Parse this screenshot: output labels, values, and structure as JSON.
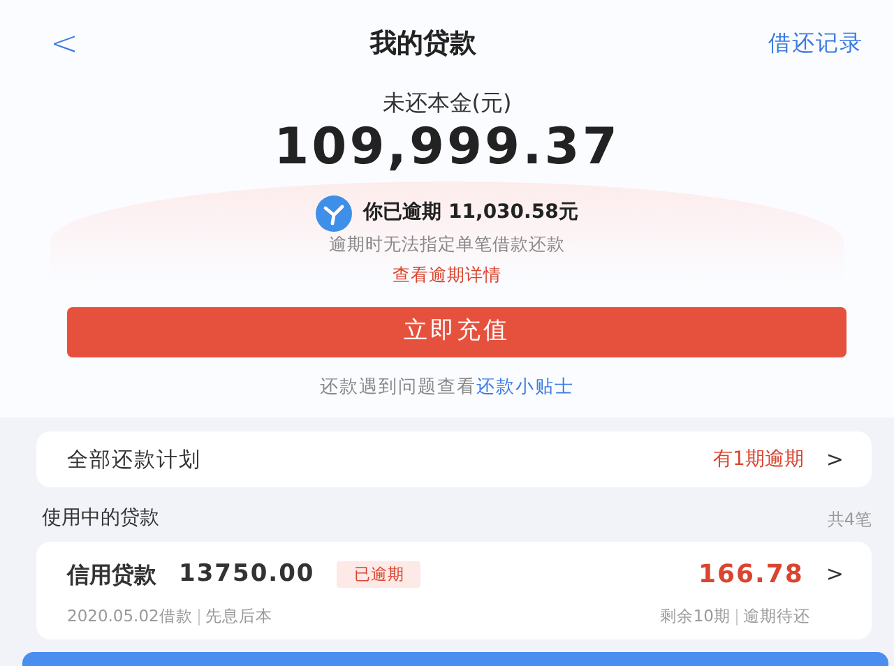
{
  "nav": {
    "back": "<",
    "title": "我的贷款",
    "action": "借还记录"
  },
  "principal": {
    "label": "未还本金(元)",
    "amount": "109,999.37"
  },
  "overdue": {
    "headline": "你已逾期 11,030.58元",
    "note": "逾期时无法指定单笔借款还款",
    "link": "查看逾期详情"
  },
  "recharge_button": "立即充值",
  "tip": {
    "text": "还款遇到问题查看",
    "link": "还款小贴士"
  },
  "plan": {
    "label": "全部还款计划",
    "status": "有1期逾期",
    "arrow": ">"
  },
  "loans_section": {
    "title": "使用中的贷款",
    "count": "共4笔"
  },
  "loans": [
    {
      "name": "信用贷款",
      "amount": "13750.00",
      "tag": "已逾期",
      "due": "166.78",
      "arrow": ">",
      "date": "2020.05.02借款",
      "method": "先息后本",
      "remaining": "剩余10期",
      "state": "逾期待还"
    }
  ]
}
